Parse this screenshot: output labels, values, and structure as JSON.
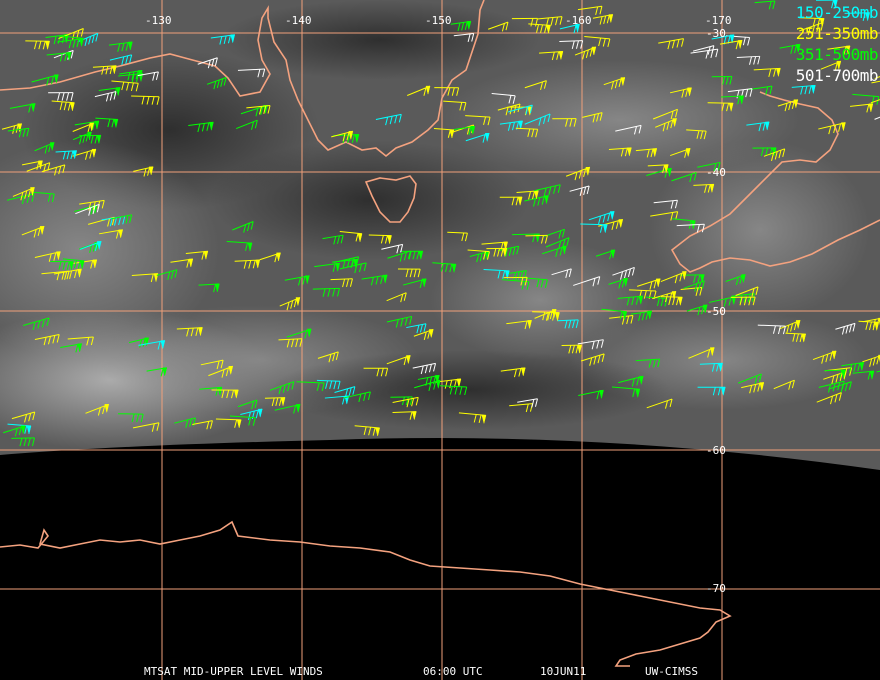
{
  "map": {
    "lon_labels": [
      "-130",
      "-140",
      "-150",
      "-160",
      "-170"
    ],
    "lat_labels": [
      "-30",
      "-40",
      "-50",
      "-60",
      "-70"
    ],
    "grid_color": "#f0a07a",
    "coast_color": "#f4a27f",
    "missing_data_color": "#000000"
  },
  "legend": [
    {
      "label": "150-250mb",
      "color": "#00ffff"
    },
    {
      "label": "251-350mb",
      "color": "#ffff00"
    },
    {
      "label": "351-500mb",
      "color": "#00ff00"
    },
    {
      "label": "501-700mb",
      "color": "#ffffff"
    }
  ],
  "footer": {
    "product": "MTSAT MID-UPPER LEVEL WINDS",
    "time": "06:00 UTC",
    "date": "10JUN11",
    "source": "UW-CIMSS"
  }
}
